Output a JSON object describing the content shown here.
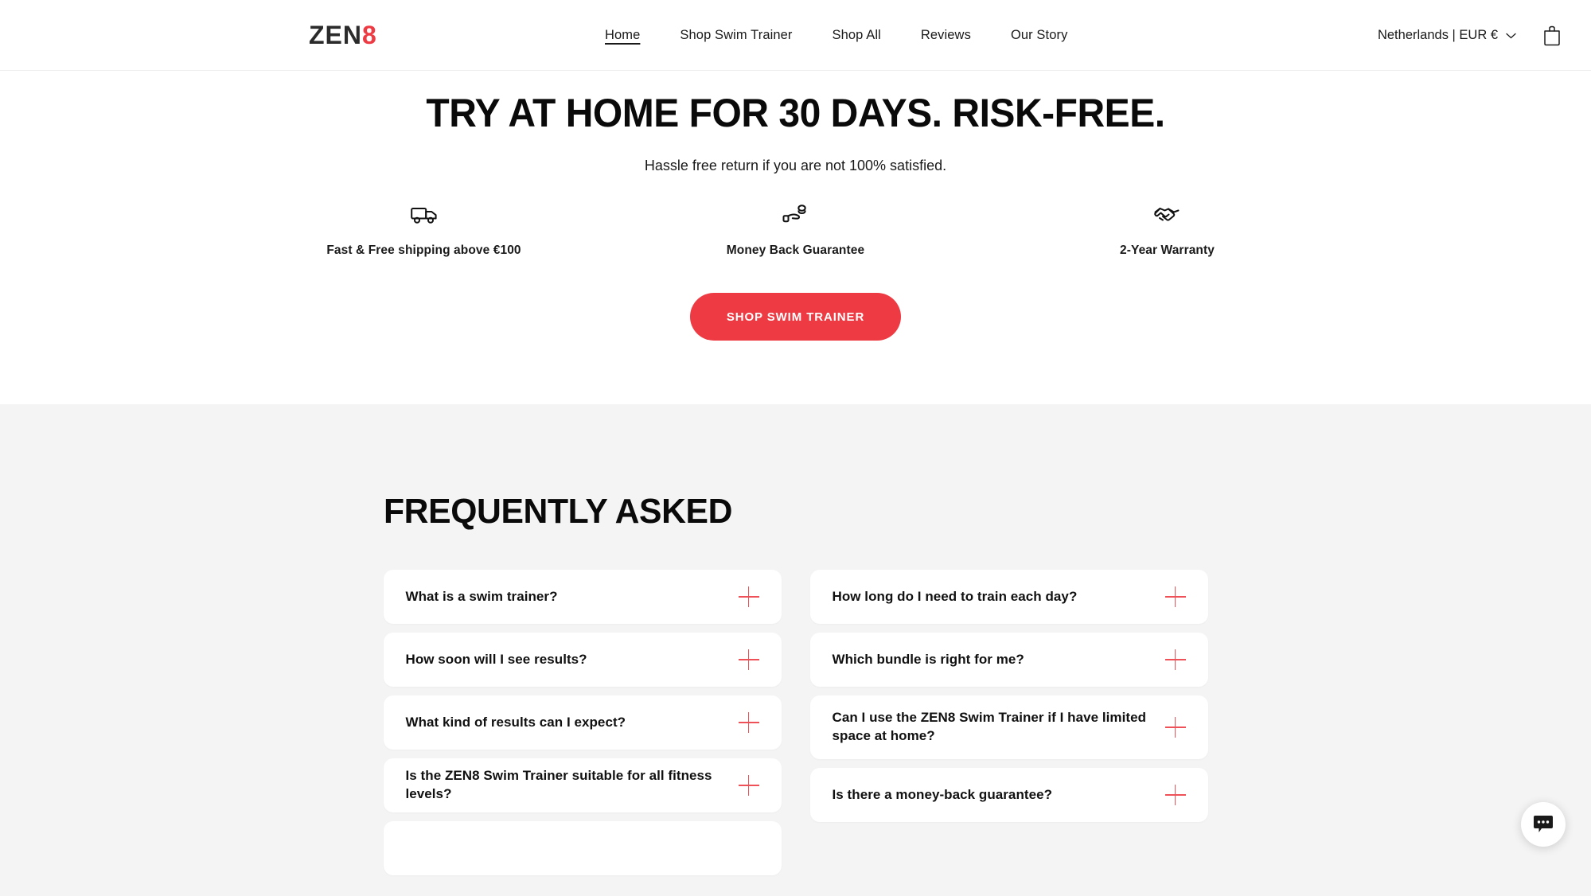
{
  "header": {
    "logo": {
      "part1": "ZEN",
      "part2": "8"
    },
    "nav": [
      {
        "label": "Home",
        "active": true
      },
      {
        "label": "Shop Swim Trainer",
        "active": false
      },
      {
        "label": "Shop All",
        "active": false
      },
      {
        "label": "Reviews",
        "active": false
      },
      {
        "label": "Our Story",
        "active": false
      }
    ],
    "locale": "Netherlands | EUR €",
    "cart_icon": "shopping-bag-icon",
    "chevron_icon": "chevron-down-icon"
  },
  "hero": {
    "title": "TRY AT HOME FOR 30 DAYS. RISK-FREE.",
    "subtitle": "Hassle free return if you are not 100% satisfied.",
    "features": [
      {
        "icon": "truck-icon",
        "label": "Fast & Free shipping above €100"
      },
      {
        "icon": "hand-coins-icon",
        "label": "Money Back Guarantee"
      },
      {
        "icon": "handshake-icon",
        "label": "2-Year Warranty"
      }
    ],
    "cta_label": "SHOP SWIM TRAINER"
  },
  "faq": {
    "title": "FREQUENTLY ASKED",
    "plus_icon": "plus-icon",
    "left_column": [
      {
        "question": "What is a swim trainer?",
        "tall": false
      },
      {
        "question": "How soon will I see results?",
        "tall": false
      },
      {
        "question": "What kind of results can I expect?",
        "tall": false
      },
      {
        "question": "Is the ZEN8 Swim Trainer suitable for all fitness levels?",
        "tall": false
      },
      {
        "question": "",
        "tall": false
      }
    ],
    "right_column": [
      {
        "question": "How long do I need to train each day?",
        "tall": false
      },
      {
        "question": "Which bundle is right for me?",
        "tall": false
      },
      {
        "question": "Can I use the ZEN8 Swim Trainer if I have limited space at home?",
        "tall": true
      },
      {
        "question": "Is there a money-back guarantee?",
        "tall": false
      }
    ]
  },
  "chat": {
    "icon": "chat-bubble-icon"
  },
  "colors": {
    "accent_red": "#ee3a42",
    "plus_red": "#ee5158",
    "faq_background": "#f4f4f4",
    "text_dark": "#111111"
  }
}
